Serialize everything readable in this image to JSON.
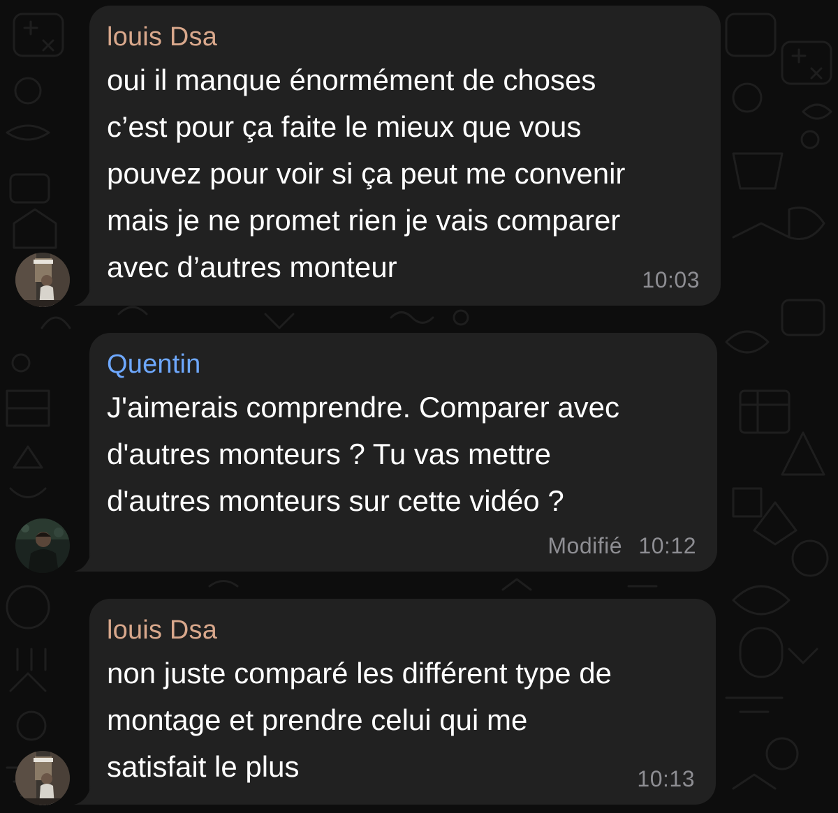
{
  "colors": {
    "background": "#0d0d0d",
    "bubble": "#212121",
    "message_text": "#ffffff",
    "meta_text": "#8e8e93",
    "sender_louis": "#d9a88c",
    "sender_quentin": "#6ea8fe"
  },
  "messages": [
    {
      "sender": "louis Dsa",
      "sender_color": "#d9a88c",
      "avatar": "louis-avatar",
      "lines": [
        "oui il manque énormément de choses",
        "c’est pour ça faite le mieux que vous",
        "pouvez pour voir si ça peut me convenir",
        "mais je ne promet rien je vais comparer",
        "avec d’autres monteur"
      ],
      "edited": "",
      "time": "10:03"
    },
    {
      "sender": "Quentin",
      "sender_color": "#6ea8fe",
      "avatar": "quentin-avatar",
      "lines": [
        "J'aimerais comprendre. Comparer avec",
        "d'autres monteurs ? Tu vas mettre",
        "d'autres monteurs sur cette vidéo ?"
      ],
      "edited": "Modifié",
      "time": "10:12"
    },
    {
      "sender": "louis Dsa",
      "sender_color": "#d9a88c",
      "avatar": "louis-avatar",
      "lines": [
        "non juste comparé les différent type de",
        "montage et prendre celui qui me",
        "satisfait le plus"
      ],
      "edited": "",
      "time": "10:13"
    }
  ]
}
